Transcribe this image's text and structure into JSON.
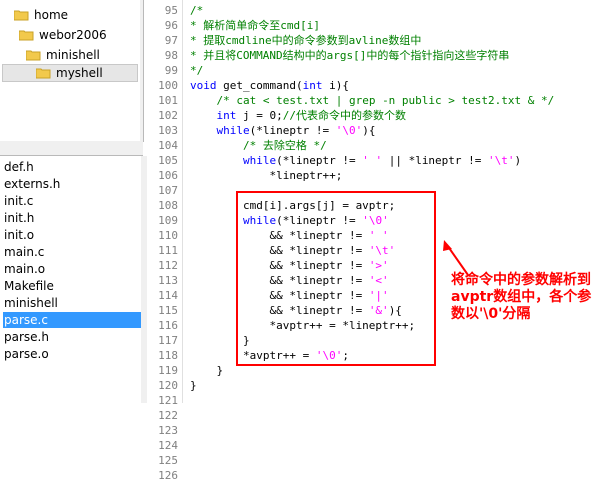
{
  "tree": {
    "items": [
      {
        "label": "home"
      },
      {
        "label": "webor2006"
      },
      {
        "label": "minishell"
      },
      {
        "label": "myshell"
      }
    ]
  },
  "files": {
    "items": [
      "def.h",
      "externs.h",
      "init.c",
      "init.h",
      "init.o",
      "main.c",
      "main.o",
      "Makefile",
      "minishell",
      "parse.c",
      "parse.h",
      "parse.o"
    ],
    "selected": "parse.c"
  },
  "code": {
    "line_numbers": [
      "95",
      "96",
      "97",
      "98",
      "99",
      "100",
      "101",
      "102",
      "103",
      "104",
      "105",
      "106",
      "107",
      "108",
      "109",
      "110",
      "111",
      "112",
      "113",
      "114",
      "115",
      "116",
      "117",
      "118",
      "119",
      "120",
      "121",
      "122",
      "123",
      "124",
      "125",
      "126"
    ],
    "lines": [
      [
        {
          "c": "cm",
          "t": "/*"
        }
      ],
      [
        {
          "c": "cm",
          "t": "* 解析简单命令至cmd[i]"
        }
      ],
      [
        {
          "c": "cm",
          "t": "* 提取cmdline中的命令参数到avline数组中"
        }
      ],
      [
        {
          "c": "cm",
          "t": "* 并且将COMMAND结构中的args[]中的每个指针指向这些字符串"
        }
      ],
      [
        {
          "c": "cm",
          "t": "*/"
        }
      ],
      [
        {
          "c": "kw",
          "t": "void"
        },
        {
          "c": "tx",
          "t": " get_command("
        },
        {
          "c": "kw",
          "t": "int"
        },
        {
          "c": "tx",
          "t": " i){"
        }
      ],
      [
        {
          "c": "tx",
          "t": "    "
        },
        {
          "c": "cm",
          "t": "/* cat < test.txt | grep -n public > test2.txt & */"
        }
      ],
      [
        {
          "c": "tx",
          "t": "    "
        },
        {
          "c": "kw",
          "t": "int"
        },
        {
          "c": "tx",
          "t": " j = 0;"
        },
        {
          "c": "cm",
          "t": "//代表命令中的参数个数"
        }
      ],
      [
        {
          "c": "tx",
          "t": "    "
        },
        {
          "c": "kw",
          "t": "while"
        },
        {
          "c": "tx",
          "t": "(*lineptr != "
        },
        {
          "c": "st",
          "t": "'\\0'"
        },
        {
          "c": "tx",
          "t": "){"
        }
      ],
      [
        {
          "c": "tx",
          "t": "        "
        },
        {
          "c": "cm",
          "t": "/* 去除空格 */"
        }
      ],
      [
        {
          "c": "tx",
          "t": "        "
        },
        {
          "c": "kw",
          "t": "while"
        },
        {
          "c": "tx",
          "t": "(*lineptr != "
        },
        {
          "c": "st",
          "t": "' '"
        },
        {
          "c": "tx",
          "t": " || *lineptr != "
        },
        {
          "c": "st",
          "t": "'\\t'"
        },
        {
          "c": "tx",
          "t": ")"
        }
      ],
      [
        {
          "c": "tx",
          "t": "            *lineptr++;"
        }
      ],
      [
        {
          "c": "tx",
          "t": ""
        }
      ],
      [
        {
          "c": "tx",
          "t": "        cmd[i].args[j] = avptr;"
        }
      ],
      [
        {
          "c": "tx",
          "t": "        "
        },
        {
          "c": "kw",
          "t": "while"
        },
        {
          "c": "tx",
          "t": "(*lineptr != "
        },
        {
          "c": "st",
          "t": "'\\0'"
        }
      ],
      [
        {
          "c": "tx",
          "t": "            && *lineptr != "
        },
        {
          "c": "st",
          "t": "' '"
        }
      ],
      [
        {
          "c": "tx",
          "t": "            && *lineptr != "
        },
        {
          "c": "st",
          "t": "'\\t'"
        }
      ],
      [
        {
          "c": "tx",
          "t": "            && *lineptr != "
        },
        {
          "c": "st",
          "t": "'>'"
        }
      ],
      [
        {
          "c": "tx",
          "t": "            && *lineptr != "
        },
        {
          "c": "st",
          "t": "'<'"
        }
      ],
      [
        {
          "c": "tx",
          "t": "            && *lineptr != "
        },
        {
          "c": "st",
          "t": "'|'"
        }
      ],
      [
        {
          "c": "tx",
          "t": "            && *lineptr != "
        },
        {
          "c": "st",
          "t": "'&'"
        },
        {
          "c": "tx",
          "t": "){"
        }
      ],
      [
        {
          "c": "tx",
          "t": "            *avptr++ = *lineptr++;"
        }
      ],
      [
        {
          "c": "tx",
          "t": "        }"
        }
      ],
      [
        {
          "c": "tx",
          "t": "        *avptr++ = "
        },
        {
          "c": "st",
          "t": "'\\0'"
        },
        {
          "c": "tx",
          "t": ";"
        }
      ],
      [
        {
          "c": "tx",
          "t": "    }"
        }
      ],
      [
        {
          "c": "tx",
          "t": "}"
        }
      ]
    ]
  },
  "annotation": {
    "text": "将命令中的参数解析到avptr数组中，各个参数以'\\0'分隔"
  },
  "colors": {
    "comment": "#008000",
    "keyword": "#0000ff",
    "string": "#ff00ff",
    "highlight": "#ff0000",
    "selection": "#3399ff"
  }
}
